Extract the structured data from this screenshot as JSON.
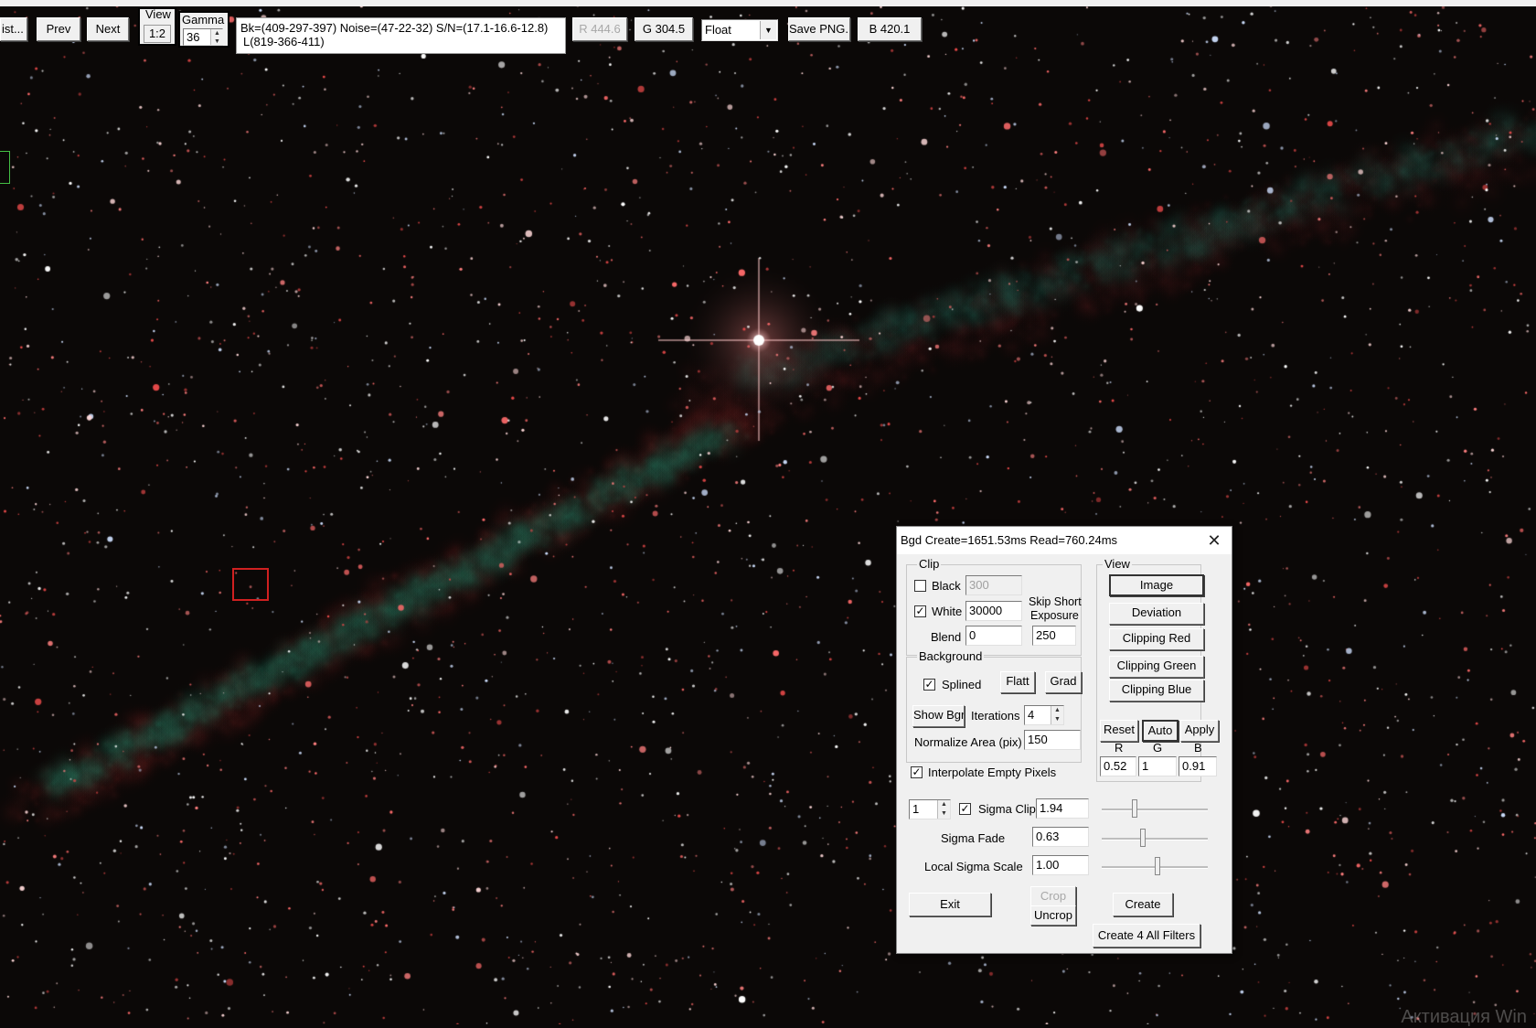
{
  "toolbar": {
    "list_label": "ist...",
    "prev_label": "Prev",
    "next_label": "Next",
    "view_label": "View",
    "view_value": "1:2",
    "gamma_label": "Gamma",
    "gamma_value": "36",
    "status_line1": "Bk=(409-297-397) Noise=(47-22-32) S/N=(17.1-16.6-12.8)",
    "status_line2": "L(819-366-411)",
    "r_label": "R 444.6",
    "g_label": "G 304.5",
    "format_value": "Float",
    "save_label": "Save PNG..",
    "b_label": "B 420.1"
  },
  "dialog": {
    "title": "Bgd Create=1651.53ms Read=760.24ms",
    "clip": {
      "group_label": "Clip",
      "black_label": "Black",
      "black_checked": false,
      "black_value": "300",
      "white_label": "White",
      "white_checked": true,
      "white_value": "30000",
      "skip_short_label_1": "Skip Short",
      "skip_short_label_2": "Exposure",
      "skip_short_value": "250",
      "blend_label": "Blend",
      "blend_value": "0"
    },
    "background": {
      "group_label": "Background",
      "splined_label": "Splined",
      "splined_checked": true,
      "flatt_label": "Flatt",
      "grad_label": "Grad",
      "show_bgr_label": "Show Bgr",
      "iterations_label": "Iterations",
      "iterations_value": "4",
      "normalize_label": "Normalize Area (pix)",
      "normalize_value": "150"
    },
    "view": {
      "group_label": "View",
      "image_label": "Image",
      "deviation_label": "Deviation",
      "clipping_red_label": "Clipping Red",
      "clipping_green_label": "Clipping Green",
      "clipping_blue_label": "Clipping Blue",
      "reset_label": "Reset",
      "auto_label": "Auto",
      "apply_label": "Apply",
      "r_header": "R",
      "g_header": "G",
      "b_header": "B",
      "r_value": "0.52",
      "g_value": "1",
      "b_value": "0.91"
    },
    "interpolate_label": "Interpolate Empty Pixels",
    "interpolate_checked": true,
    "counter_value": "1",
    "sigma_clip_label": "Sigma Clip",
    "sigma_clip_checked": true,
    "sigma_clip_value": "1.94",
    "sigma_fade_label": "Sigma Fade",
    "sigma_fade_value": "0.63",
    "local_sigma_label": "Local Sigma Scale",
    "local_sigma_value": "1.00",
    "exit_label": "Exit",
    "crop_label": "Crop",
    "uncrop_label": "Uncrop",
    "create_label": "Create",
    "create4_label": "Create 4 All Filters",
    "close_icon": "close-icon"
  },
  "watermark": "Активация Win"
}
